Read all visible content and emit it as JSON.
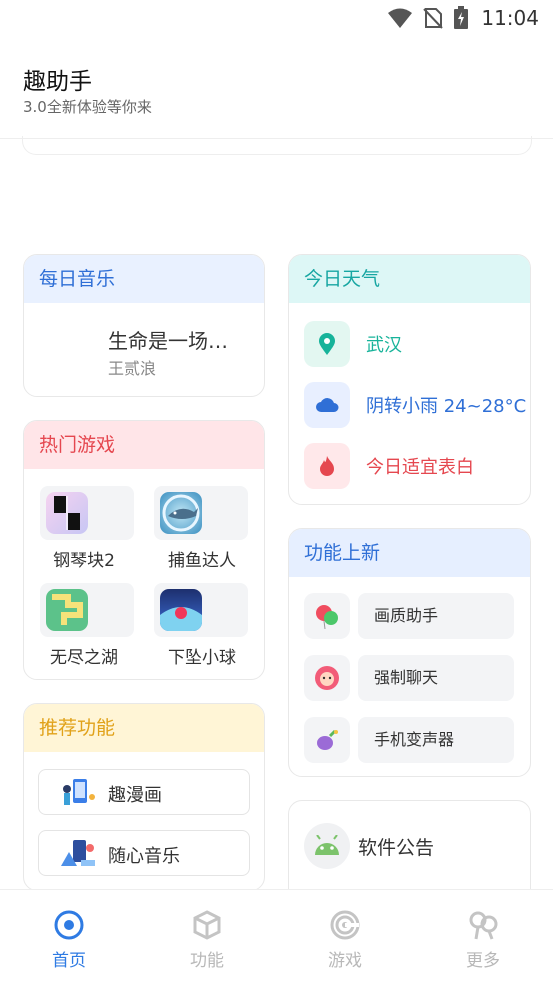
{
  "status_bar": {
    "time": "11:04"
  },
  "header": {
    "title": "趣助手",
    "subtitle": "3.0全新体验等你来"
  },
  "music": {
    "title": "每日音乐",
    "song": "生命是一场…",
    "artist": "王贰浪"
  },
  "weather": {
    "title": "今日天气",
    "city": "武汉",
    "forecast": "阴转小雨 24~28°C",
    "dress": "今日适宜表白",
    "colors": {
      "city": "#17b39a",
      "forecast": "#2f6fd6",
      "dress": "#e5474f"
    }
  },
  "games": {
    "title": "热门游戏",
    "items": [
      {
        "label": "钢琴块2",
        "icon": "piano-tiles-icon"
      },
      {
        "label": "捕鱼达人",
        "icon": "shark-icon"
      },
      {
        "label": "无尽之湖",
        "icon": "lake-path-icon"
      },
      {
        "label": "下坠小球",
        "icon": "falling-ball-icon"
      }
    ]
  },
  "features_new": {
    "title": "功能上新",
    "items": [
      {
        "label": "画质助手",
        "icon": "balloon-icon"
      },
      {
        "label": "强制聊天",
        "icon": "lion-icon"
      },
      {
        "label": "手机变声器",
        "icon": "eggplant-icon"
      }
    ]
  },
  "recommended": {
    "title": "推荐功能",
    "items": [
      {
        "label": "趣漫画",
        "icon": "comic-icon"
      },
      {
        "label": "随心音乐",
        "icon": "music-illustration-icon"
      }
    ]
  },
  "notice": {
    "label": "软件公告",
    "icon": "android-icon"
  },
  "nav": [
    {
      "label": "首页",
      "icon": "home-target-icon",
      "active": true
    },
    {
      "label": "功能",
      "icon": "cube-icon",
      "active": false
    },
    {
      "label": "游戏",
      "icon": "spiral-icon",
      "active": false
    },
    {
      "label": "更多",
      "icon": "more-icon",
      "active": false
    }
  ],
  "colors": {
    "accent": "#2f7be3",
    "nav_inactive": "#b8b8b8"
  }
}
